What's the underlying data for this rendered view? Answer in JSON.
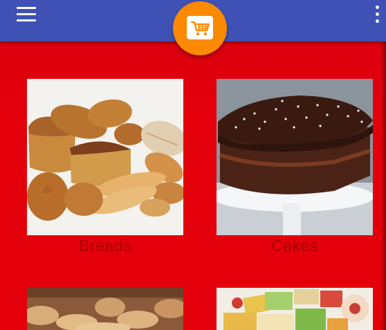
{
  "appbar": {
    "color": "#3f51b5",
    "menu_icon": "hamburger-menu-icon",
    "more_icon": "more-vertical-icon"
  },
  "fab": {
    "color": "#fb8a00",
    "icon": "shopping-cart-icon"
  },
  "background_color": "#e0000a",
  "categories": [
    {
      "label": "Breads",
      "image": "breads-photo"
    },
    {
      "label": "Cakes",
      "image": "cakes-photo"
    },
    {
      "label": "",
      "image": "cookies-photo"
    },
    {
      "label": "",
      "image": "sweets-photo"
    }
  ]
}
